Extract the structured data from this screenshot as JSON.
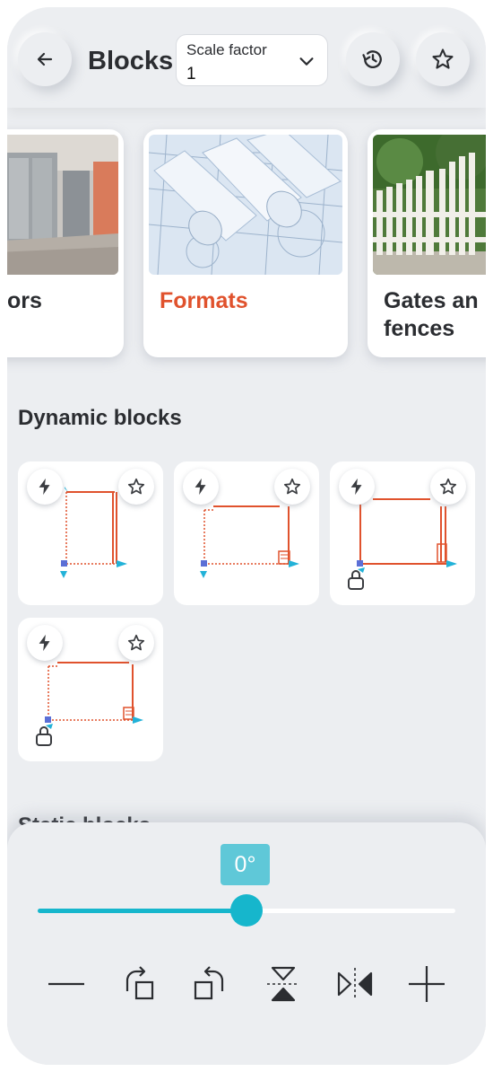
{
  "header": {
    "title": "Blocks",
    "scale_label": "Scale factor",
    "scale_value": "1",
    "back_icon": "arrow-left-icon",
    "history_icon": "history-icon",
    "favorite_icon": "star-icon"
  },
  "categories": [
    {
      "label": "ors",
      "active": false
    },
    {
      "label": "Formats",
      "active": true
    },
    {
      "label": "Gates an fences",
      "line1": "Gates an",
      "line2": "fences",
      "active": false
    }
  ],
  "dynamic_section": {
    "title": "Dynamic blocks",
    "items": [
      {
        "name": "dynamic-block-1",
        "icons": [
          "lightning-icon",
          "star-icon"
        ]
      },
      {
        "name": "dynamic-block-2",
        "icons": [
          "lightning-icon",
          "star-icon"
        ]
      },
      {
        "name": "dynamic-block-3",
        "icons": [
          "lightning-icon",
          "star-icon"
        ]
      },
      {
        "name": "dynamic-block-4",
        "icons": [
          "lightning-icon",
          "star-icon"
        ]
      }
    ]
  },
  "static_section": {
    "title": "Static blocks"
  },
  "rotation": {
    "angle_label": "0°",
    "slider_fraction": 0.5
  },
  "tools": [
    "minus-icon",
    "rotate-cw-icon",
    "rotate-ccw-icon",
    "flip-vertical-icon",
    "flip-horizontal-icon",
    "plus-icon"
  ],
  "colors": {
    "accent": "#16b6cc",
    "badge": "#5fc8d8",
    "active_category": "#e0522d",
    "block_line": "#e0522d",
    "grip_blue": "#5b6fd6",
    "grip_cyan": "#22b2d8",
    "background": "#eceef1"
  }
}
